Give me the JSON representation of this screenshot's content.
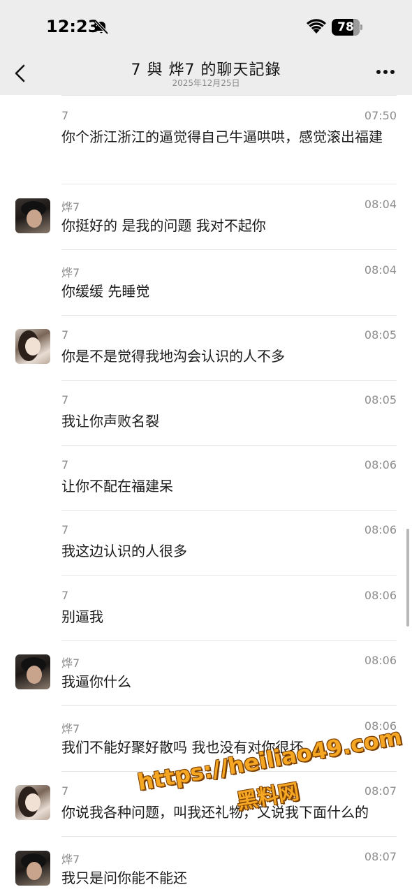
{
  "status_bar": {
    "time": "12:23",
    "battery": "78"
  },
  "nav": {
    "title": "7 與 烨7 的聊天記錄",
    "date": "2025年12月25日"
  },
  "messages": [
    {
      "sender": "7",
      "time": "07:50",
      "avatar": "none",
      "text": "你个浙江浙江的逼觉得自己牛逼哄哄，感觉滚出福建"
    },
    {
      "sender": "烨7",
      "time": "08:04",
      "avatar": "male",
      "text": "你挺好的 是我的问题 我对不起你"
    },
    {
      "sender": "烨7",
      "time": "08:04",
      "avatar": "none",
      "text": "你缓缓 先睡觉"
    },
    {
      "sender": "7",
      "time": "08:05",
      "avatar": "female",
      "text": "你是不是觉得我地沟会认识的人不多"
    },
    {
      "sender": "7",
      "time": "08:05",
      "avatar": "none",
      "text": "我让你声败名裂"
    },
    {
      "sender": "7",
      "time": "08:06",
      "avatar": "none",
      "text": "让你不配在福建呆"
    },
    {
      "sender": "7",
      "time": "08:06",
      "avatar": "none",
      "text": "我这边认识的人很多"
    },
    {
      "sender": "7",
      "time": "08:06",
      "avatar": "none",
      "text": "别逼我"
    },
    {
      "sender": "烨7",
      "time": "08:06",
      "avatar": "male",
      "text": "我逼你什么"
    },
    {
      "sender": "烨7",
      "time": "08:06",
      "avatar": "none",
      "text": "我们不能好聚好散吗 我也没有对你很坏..."
    },
    {
      "sender": "7",
      "time": "08:07",
      "avatar": "female",
      "text": "你说我各种问题，叫我还礼物，又说我下面什么的"
    },
    {
      "sender": "烨7",
      "time": "08:07",
      "avatar": "male",
      "text": "我只是问你能不能还"
    }
  ],
  "watermark": {
    "url": "https://heiliao49.com",
    "name": "黑料网"
  },
  "colors": {
    "header_bg": "#ededed",
    "watermark": "#f5a623"
  }
}
